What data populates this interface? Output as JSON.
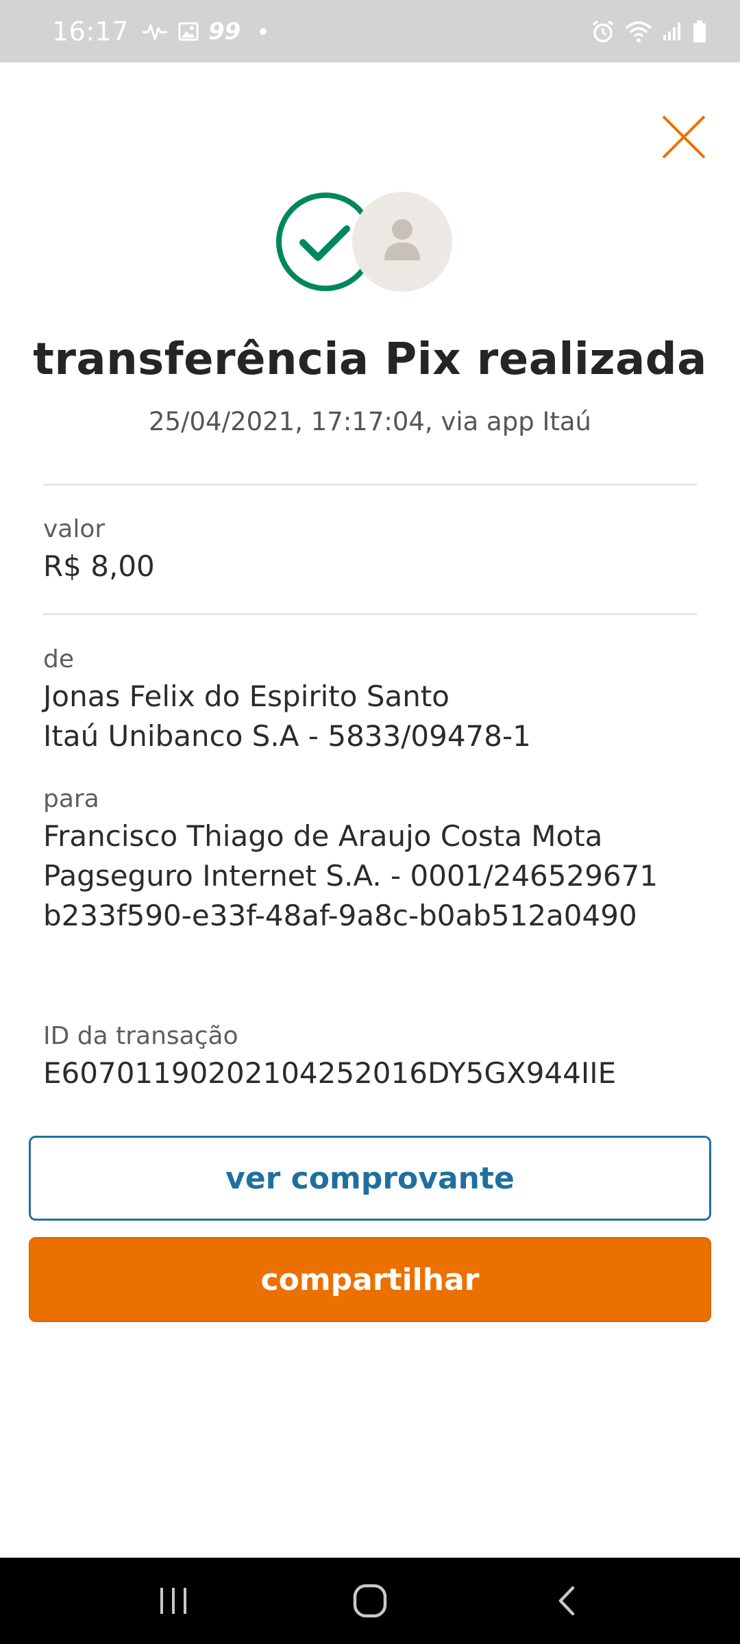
{
  "status_bar": {
    "time": "16:17",
    "notification_count": "99",
    "icons": [
      "activity-icon",
      "image-icon",
      "alarm-icon",
      "wifi-icon",
      "signal-icon",
      "battery-icon"
    ]
  },
  "header": {
    "close_icon": "close-icon"
  },
  "hero": {
    "check_icon": "check-circle-icon",
    "avatar_icon": "person-icon",
    "title": "transferência Pix realizada",
    "subtitle": "25/04/2021,  17:17:04, via app Itaú"
  },
  "details": {
    "valor_label": "valor",
    "valor_value": "R$ 8,00",
    "de_label": "de",
    "de_name": "Jonas Felix do Espirito Santo",
    "de_bank": "Itaú Unibanco S.A - 5833/09478-1",
    "para_label": "para",
    "para_name": "Francisco Thiago de Araujo Costa Mota",
    "para_bank": "Pagseguro Internet S.A. - 0001/246529671",
    "para_key": "b233f590-e33f-48af-9a8c-b0ab512a0490",
    "id_label": "ID da transação",
    "id_value": "E60701190202104252016DY5GX944IIE"
  },
  "actions": {
    "receipt_label": "ver comprovante",
    "share_label": "compartilhar"
  },
  "colors": {
    "accent_orange": "#ec7000",
    "accent_blue": "#1f6f9e",
    "success_green": "#00875f"
  },
  "nav_bar": {
    "icons": [
      "recent-apps-icon",
      "home-icon",
      "back-icon"
    ]
  }
}
